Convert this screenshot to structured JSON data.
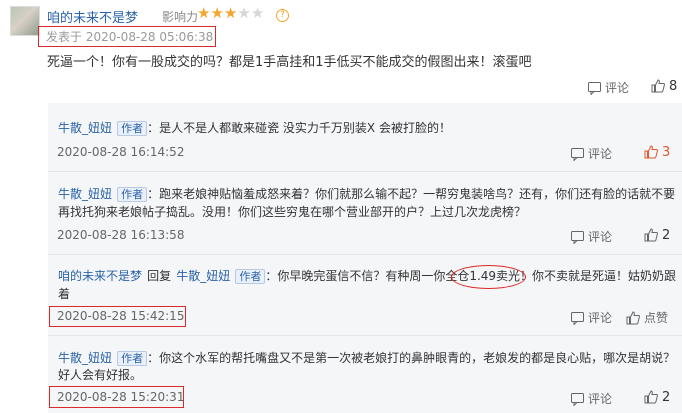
{
  "main_comment": {
    "username": "咱的未来不是梦",
    "influence_label": "影响力",
    "rating": {
      "value": 3,
      "max": 5,
      "color_on": "#f2a72e",
      "color_off": "#d6d6d6"
    },
    "help_icon": "question-circle-icon",
    "post_time": "发表于 2020-08-28 05:06:38",
    "text": "死逼一个！你有一股成交的吗？都是1手高挂和1手低买不能成交的假图出来！滚蛋吧",
    "comment_label": "评论",
    "like_count": "8"
  },
  "replies": [
    {
      "username": "牛散_妞妞",
      "badge": "作者",
      "line1": "：是人不是人都敢来碰瓷 没实力千万别装X 会被打脸的！",
      "time": "2020-08-28 16:14:52",
      "comment_label": "评论",
      "like_label": "3"
    },
    {
      "username": "牛散_妞妞",
      "badge": "作者",
      "line1": "：跑来老娘神贴恼羞成怒来着？你们就那么输不起？一帮穷鬼装啥鸟？还有，你们还有脸的话就不要",
      "line2": "再找托狗来老娘帖子捣乱。没用！你们这些穷鬼在哪个营业部开的户？上过几次龙虎榜？",
      "time": "2020-08-28 16:13:58",
      "comment_label": "评论",
      "like_label": "2"
    },
    {
      "username": "咱的未来不是梦",
      "reply_word": "回复",
      "reply_to": "牛散_妞妞",
      "badge": "作者",
      "line1": "：你早晚完蛋信不信？有种周一你全仓1.49卖光！你不卖就是死逼！姑奶奶跟",
      "line2": "着",
      "time": "2020-08-28 15:42:15",
      "comment_label": "评论",
      "like_label": "点赞"
    },
    {
      "username": "牛散_妞妞",
      "badge": "作者",
      "line1": "：你这个水军的帮托嘴盘又不是第一次被老娘打的鼻肿眼青的，老娘发的都是良心贴，哪次是胡说？",
      "line2": "好人会有好报。",
      "time": "2020-08-28 15:20:31",
      "comment_label": "评论",
      "like_label": "2"
    }
  ],
  "colors": {
    "link": "#2a63a8",
    "annotation_red": "#d92b2b",
    "reply_bg": "#f5f6f8",
    "hot_like": "#e4542b"
  }
}
